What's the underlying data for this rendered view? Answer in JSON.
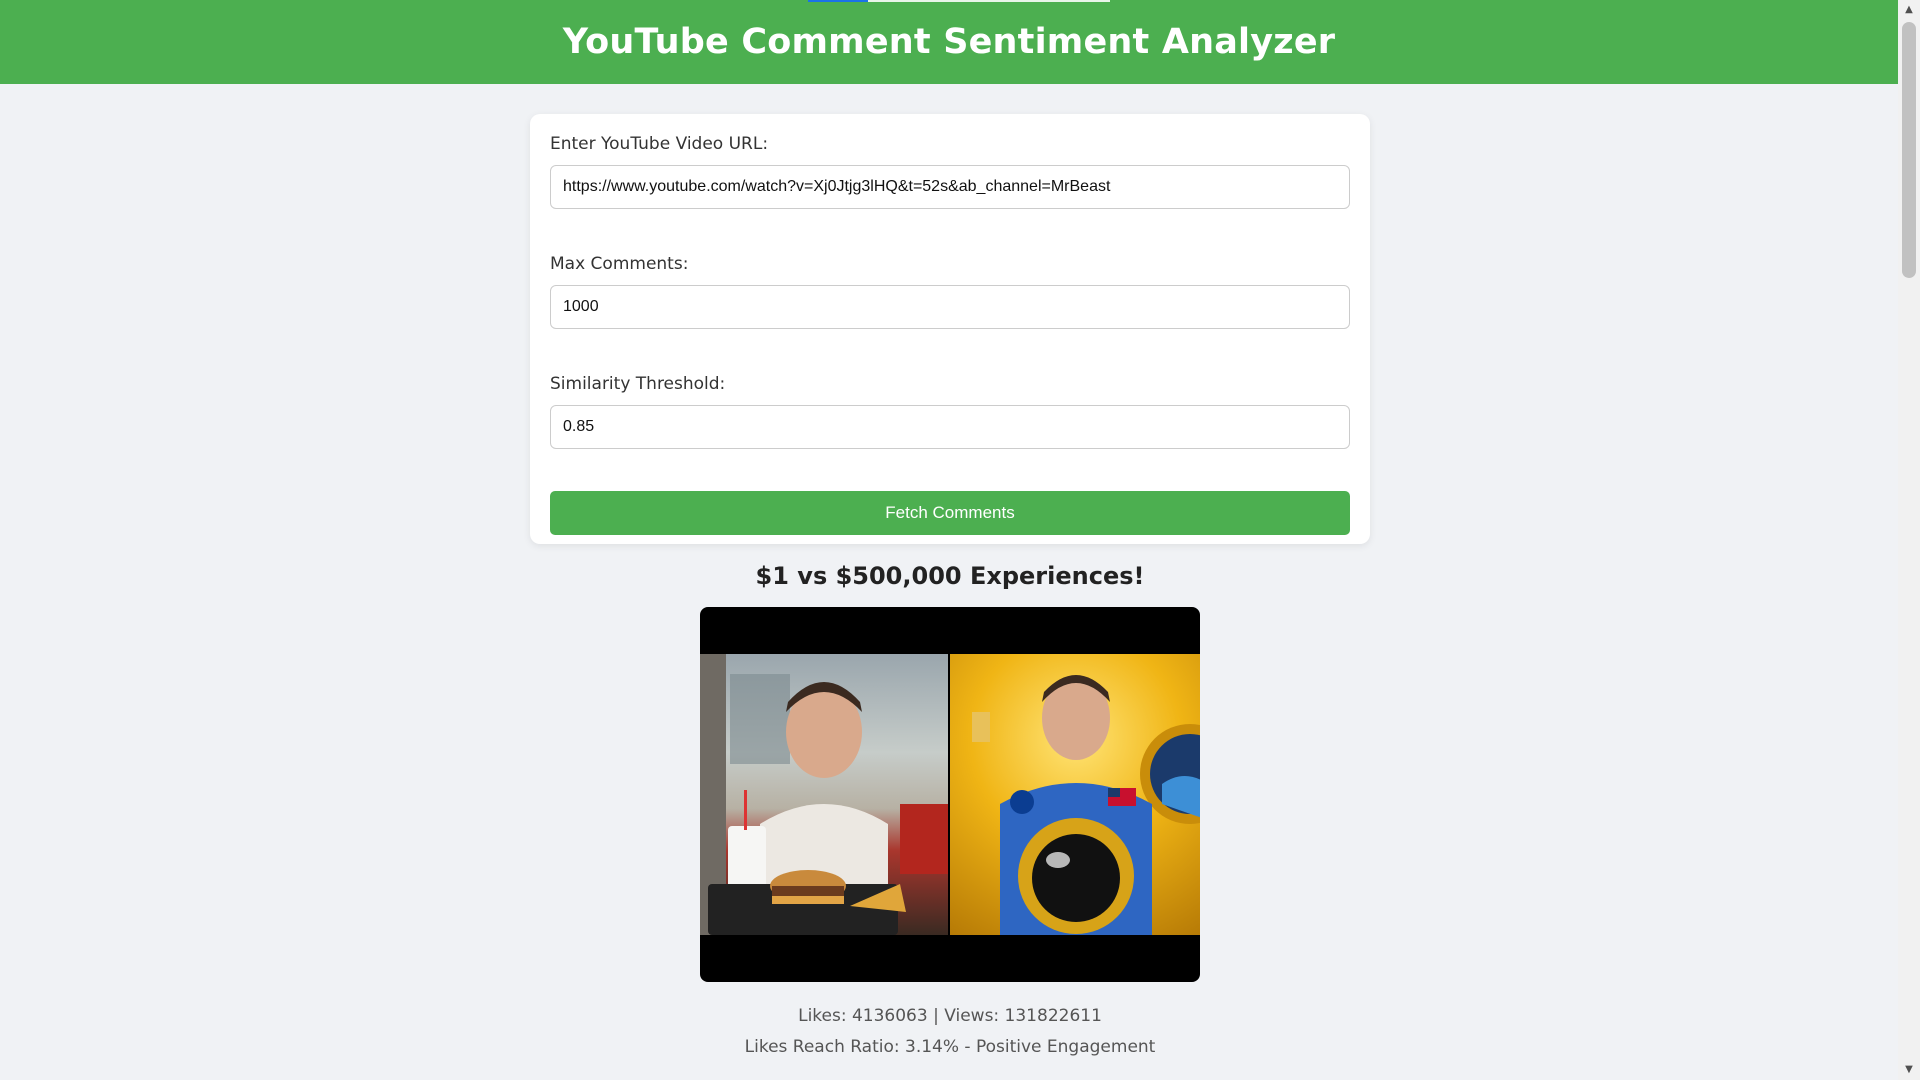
{
  "header": {
    "title": "YouTube Comment Sentiment Analyzer"
  },
  "form": {
    "url_label": "Enter YouTube Video URL:",
    "url_value": "https://www.youtube.com/watch?v=Xj0Jtjg3lHQ&t=52s&ab_channel=MrBeast",
    "max_label": "Max Comments:",
    "max_value": "1000",
    "threshold_label": "Similarity Threshold:",
    "threshold_value": "0.85",
    "button_label": "Fetch Comments"
  },
  "video": {
    "title": "$1 vs $500,000 Experiences!",
    "stats_line": "Likes: 4136063 | Views: 131822611",
    "ratio_line": "Likes Reach Ratio: 3.14% - Positive Engagement"
  },
  "colors": {
    "accent": "#4caf50",
    "background": "#f0f2f5"
  }
}
